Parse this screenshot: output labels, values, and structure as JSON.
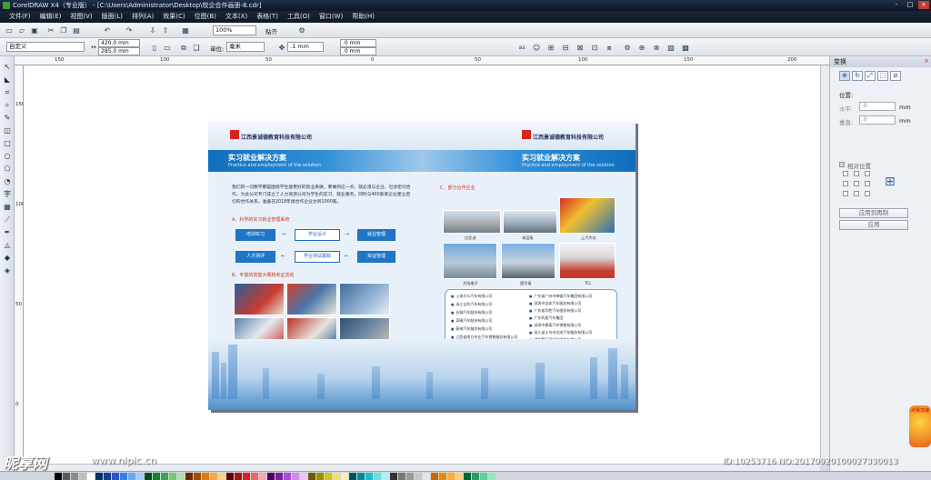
{
  "window": {
    "title": "CorelDRAW X4（专业版） - [C:\\Users\\Administrator\\Desktop\\校企合作画册-8.cdr]",
    "controls": [
      "-",
      "□",
      "×"
    ]
  },
  "menu": [
    "文件(F)",
    "编辑(E)",
    "视图(V)",
    "版面(L)",
    "排列(A)",
    "效果(C)",
    "位图(B)",
    "文本(X)",
    "表格(T)",
    "工具(O)",
    "窗口(W)",
    "帮助(H)"
  ],
  "toolbar": {
    "zoom": "100%",
    "snap": "贴齐",
    "preset": "自定义",
    "width": "420.0 mm",
    "height": "285.0 mm",
    "units_label": "单位:",
    "units": "毫米",
    "nudge": ".1 mm",
    "dup_x": ".0 mm",
    "dup_y": ".0 mm"
  },
  "ruler": {
    "h_ticks": [
      "150",
      "100",
      "50",
      "0",
      "50",
      "100",
      "150",
      "200",
      "250",
      "300",
      "350",
      "400",
      "450",
      "500",
      "550"
    ],
    "v_ticks": [
      "150",
      "100",
      "50",
      "0",
      "50",
      "100",
      "150",
      "200",
      "250"
    ],
    "units": "毫米"
  },
  "document": {
    "company": "江西景诚德教育科技有限公司",
    "left_title": "实习就业解决方案",
    "left_sub": "Practice and employment of the solution",
    "right_title": "实习就业解决方案",
    "right_sub": "Practice and employment of the solution",
    "intro": "我们的一切教学都是围绕学生能更好的就业来做，要做到这一点，就必须与企业、社会密切合作。为此公司专门成立了人力资源公司为学生的实习、就业服务。同时与400家家企业建立密切的合作关系，准备在2018年接合作企业达到1000家。",
    "sec_a": "A、科学的实习就业管理系统",
    "sec_b": "B、丰富的技能大赛和考证活动",
    "sec_c": "C、部分合作企业",
    "flow": [
      "培训实习",
      "学业设计",
      "就业管理",
      "人才测评",
      "学业测试跟踪",
      "双证管理"
    ],
    "captions": [
      "比亚迪",
      "本田泰",
      "上汽大众",
      "北京现代",
      "大陆电子",
      "国华泰",
      "TCL"
    ],
    "partners_left": [
      "上海大众汽车有限公司",
      "浙江吉利汽车有限公司",
      "长城汽车股份有限公司",
      "奇瑞汽车股份有限公司",
      "蔚来汽车服务有限公司",
      "江西省南方车业汽车销售服务有限公司",
      "江西长安汽车销售服务有限公司",
      "浙江吉利汽车销售有限公司"
    ],
    "partners_right": [
      "广东省广州市神骏汽车集团有限公司",
      "深圳市宝安汽车服务有限公司",
      "广东省华胜汽车服务有限公司",
      "广东利星汽车集团",
      "深圳市景泰汽车销售有限公司",
      "浙江省义乌市文成汽车服务有限公司",
      "湖北楚天骏汽车服务有限公司",
      "江西景鑫汽车服务有限公司",
      "江西南广汽车集团"
    ]
  },
  "docker": {
    "title": "变换",
    "position_label": "位置:",
    "h_label": "水平:",
    "v_label": "垂直:",
    "h_value": ".0",
    "v_value": ".0",
    "mm": "mm",
    "relative": "相对位置",
    "apply_dup": "应用到再制",
    "apply": "应用"
  },
  "watermark": {
    "brand": "昵享网",
    "url": "www.nipic.cn",
    "id": "ID:10253716 NO:20170920100027330013",
    "badge": "点我加速"
  },
  "palette": [
    "#000000",
    "#5a5a5a",
    "#8c8c8c",
    "#bdbdbd",
    "#ffffff",
    "#003366",
    "#1a3c8f",
    "#2a56c6",
    "#3f7fe0",
    "#69a6f2",
    "#a5cbf7",
    "#004d1a",
    "#1f7a32",
    "#3ca64f",
    "#75c77a",
    "#b0e0b2",
    "#6b2a00",
    "#a14d00",
    "#d67c1a",
    "#f4a94a",
    "#f7d28b",
    "#660000",
    "#a31515",
    "#e02020",
    "#f26565",
    "#f7a8a8",
    "#4d0066",
    "#7a1f9e",
    "#a64fd0",
    "#cc8ce6",
    "#eac5f4",
    "#665c00",
    "#9e8e00",
    "#d6c21a",
    "#f2e165",
    "#f7efae",
    "#00555c",
    "#008c96",
    "#1fbfc9",
    "#72dbe0",
    "#b5eef0",
    "#333333",
    "#777777",
    "#999999",
    "#c8c8c8",
    "#e6e6e6",
    "#cc6600",
    "#e68a00",
    "#ffad33",
    "#ffd080",
    "#006633",
    "#339966",
    "#66cc99",
    "#99e6c2"
  ]
}
